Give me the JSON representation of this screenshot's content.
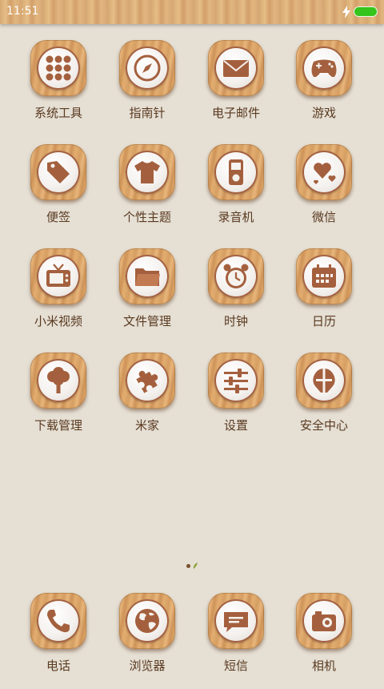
{
  "status_bar": {
    "time": "11:51",
    "battery_icon": "battery-full-icon",
    "charging_icon": "lightning-bolt-icon"
  },
  "apps": [
    {
      "label": "系统工具",
      "icon": "system-tools-folder-icon"
    },
    {
      "label": "指南针",
      "icon": "compass-icon"
    },
    {
      "label": "电子邮件",
      "icon": "envelope-icon"
    },
    {
      "label": "游戏",
      "icon": "gamepad-icon"
    },
    {
      "label": "便签",
      "icon": "tag-icon"
    },
    {
      "label": "个性主题",
      "icon": "tshirt-icon"
    },
    {
      "label": "录音机",
      "icon": "recorder-icon"
    },
    {
      "label": "微信",
      "icon": "hearts-icon"
    },
    {
      "label": "小米视频",
      "icon": "tv-icon"
    },
    {
      "label": "文件管理",
      "icon": "folder-icon"
    },
    {
      "label": "时钟",
      "icon": "alarm-clock-icon"
    },
    {
      "label": "日历",
      "icon": "calendar-icon"
    },
    {
      "label": "下载管理",
      "icon": "tree-icon"
    },
    {
      "label": "米家",
      "icon": "puzzle-icon"
    },
    {
      "label": "设置",
      "icon": "sliders-icon"
    },
    {
      "label": "安全中心",
      "icon": "shield-icon"
    }
  ],
  "dock": [
    {
      "label": "电话",
      "icon": "phone-icon"
    },
    {
      "label": "浏览器",
      "icon": "globe-icon"
    },
    {
      "label": "短信",
      "icon": "message-icon"
    },
    {
      "label": "相机",
      "icon": "camera-icon"
    }
  ],
  "page_indicator": {
    "pages": 2,
    "current": 1
  },
  "colors": {
    "background": "#e5dfd4",
    "icon_glyph": "#a4603e",
    "label": "#5a3a20",
    "battery": "#35c41b"
  }
}
